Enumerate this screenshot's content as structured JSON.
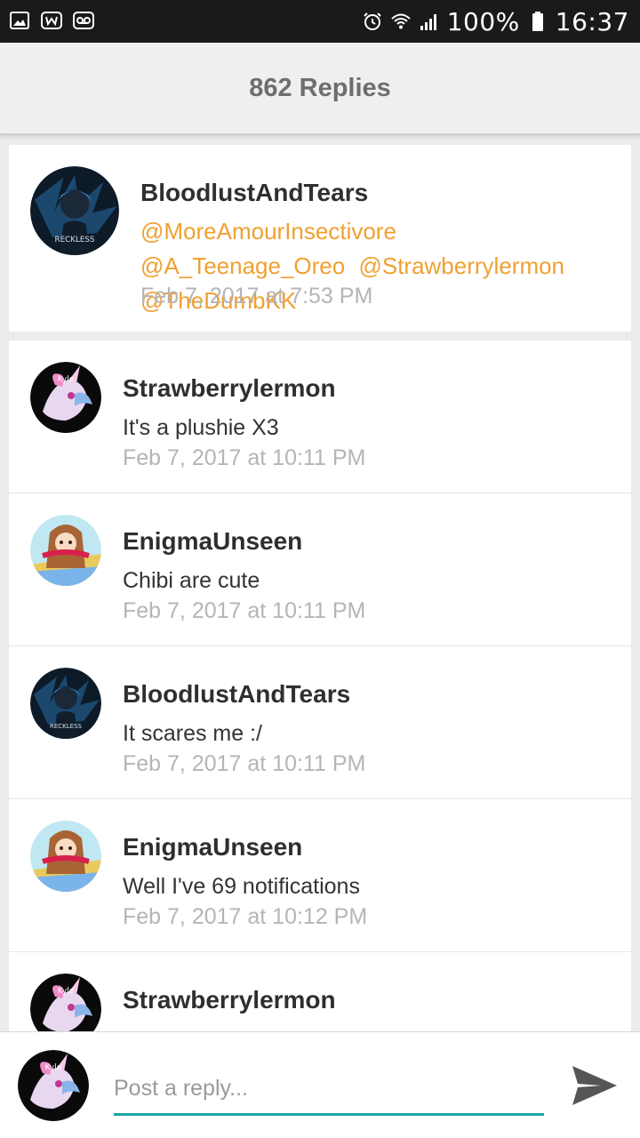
{
  "status_bar": {
    "battery": "100%",
    "time": "16:37",
    "icons": [
      "image-icon",
      "w-app-icon",
      "voicemail-icon",
      "alarm-icon",
      "wifi-icon",
      "signal-icon",
      "battery-icon"
    ]
  },
  "header": {
    "title": "862 Replies"
  },
  "original_post": {
    "username": "BloodlustAndTears",
    "mentions": [
      "@MoreAmourInsectivore",
      "@A_Teenage_Oreo",
      "@Strawberrylermon",
      "@TheDumbKK"
    ],
    "timestamp": "Feb 7, 2017 at 7:53 PM",
    "avatar": "dark-anime-avatar",
    "avatar_text": "RECKLESS"
  },
  "replies": [
    {
      "username": "Strawberrylermon",
      "text": "It's a plushie X3",
      "timestamp": "Feb 7, 2017 at 10:11 PM",
      "avatar": "pink-unicorn-avatar",
      "avatar_text": "Kyle"
    },
    {
      "username": "EnigmaUnseen",
      "text": "Chibi are cute",
      "timestamp": "Feb 7, 2017 at 10:11 PM",
      "avatar": "anime-girl-avatar"
    },
    {
      "username": "BloodlustAndTears",
      "text": "It scares me :/",
      "timestamp": "Feb 7, 2017 at 10:11 PM",
      "avatar": "dark-anime-avatar",
      "avatar_text": "RECKLESS"
    },
    {
      "username": "EnigmaUnseen",
      "text": "Well I've 69 notifications",
      "timestamp": "Feb 7, 2017 at 10:12 PM",
      "avatar": "anime-girl-avatar"
    },
    {
      "username": "Strawberrylermon",
      "text": "",
      "timestamp": "",
      "avatar": "pink-unicorn-avatar",
      "avatar_text": "Kyle"
    }
  ],
  "composer": {
    "placeholder": "Post a reply...",
    "value": "",
    "avatar": "pink-unicorn-avatar",
    "avatar_text": "Kyle"
  },
  "colors": {
    "mention": "#f0a030",
    "accent": "#1aa6a6",
    "timestamp": "#b5b5b5",
    "header_text": "#6e6e6e",
    "status_bar": "#1a1a1a"
  }
}
